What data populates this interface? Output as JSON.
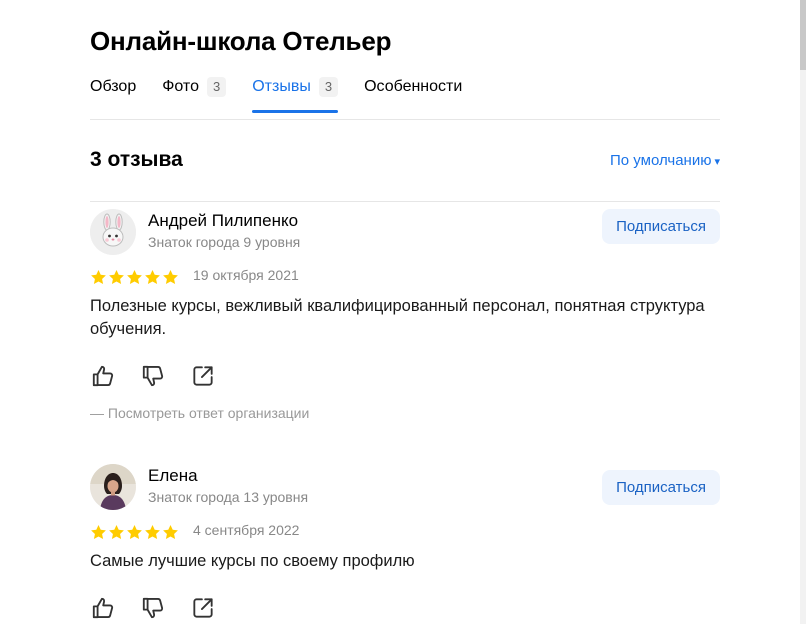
{
  "org": {
    "title": "Онлайн-школа Отельер"
  },
  "tabs": [
    {
      "label": "Обзор",
      "count": null
    },
    {
      "label": "Фото",
      "count": "3"
    },
    {
      "label": "Отзывы",
      "count": "3"
    },
    {
      "label": "Особенности",
      "count": null
    }
  ],
  "reviews_header": {
    "count_label": "3 отзыва",
    "sort_label": "По умолчанию",
    "sort_caret": "▾"
  },
  "reviews": [
    {
      "author": "Андрей Пилипенко",
      "level": "Знаток города 9 уровня",
      "subscribe_label": "Подписаться",
      "rating": 5,
      "date": "19 октября 2021",
      "text": "Полезные курсы, вежливый квалифицированный персонал, понятная структура обучения.",
      "org_reply_label": "— Посмотреть ответ организации",
      "avatar_icon": "bunny-emoji-icon"
    },
    {
      "author": "Елена",
      "level": "Знаток города 13 уровня",
      "subscribe_label": "Подписаться",
      "rating": 5,
      "date": "4 сентября 2022",
      "text": "Самые лучшие курсы по своему профилю",
      "avatar_icon": "user-photo"
    }
  ],
  "icons": {
    "like": "thumbs-up-icon",
    "dislike": "thumbs-down-icon",
    "share": "share-icon",
    "star": "star-icon"
  },
  "colors": {
    "accent": "#1a73e8",
    "star": "#ffcc00",
    "muted": "#888888",
    "subscribe_bg": "#eef4fd"
  }
}
